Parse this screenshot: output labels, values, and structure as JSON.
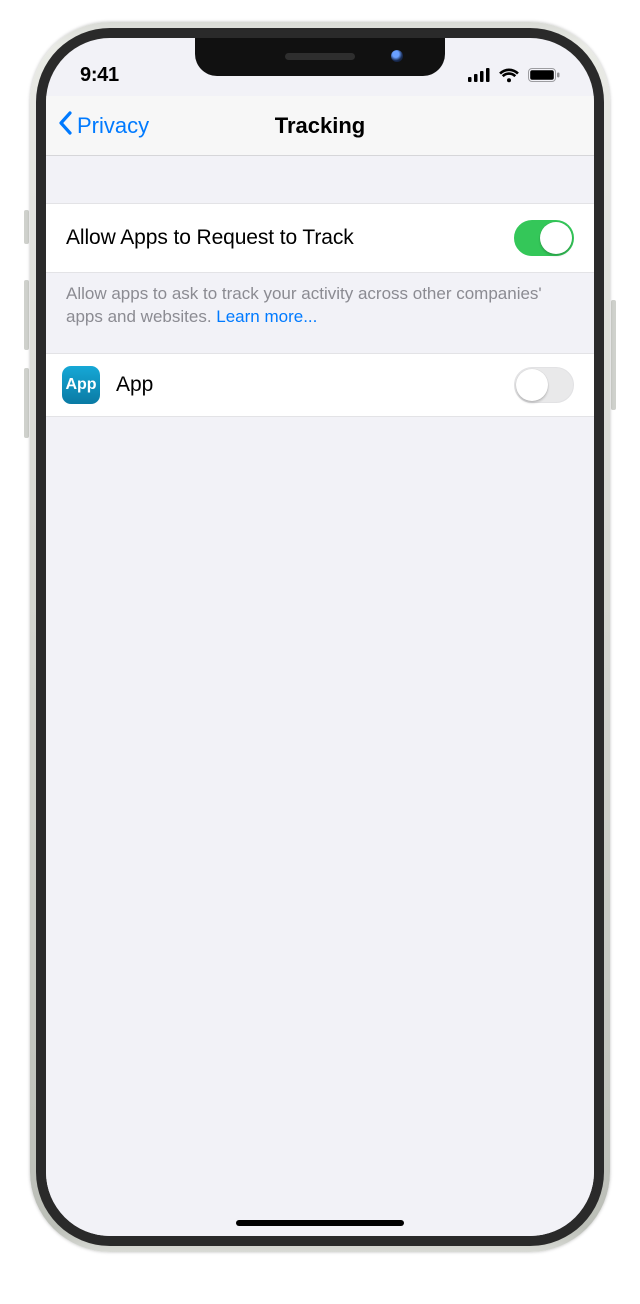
{
  "status": {
    "time": "9:41"
  },
  "nav": {
    "back_label": "Privacy",
    "title": "Tracking"
  },
  "settings": {
    "allow_label": "Allow Apps to Request to Track",
    "allow_on": true,
    "footer_text": "Allow apps to ask to track your activity across other companies' apps and websites. ",
    "footer_link": "Learn more..."
  },
  "apps": [
    {
      "name": "App",
      "icon_text": "App",
      "tracking_on": false
    }
  ]
}
